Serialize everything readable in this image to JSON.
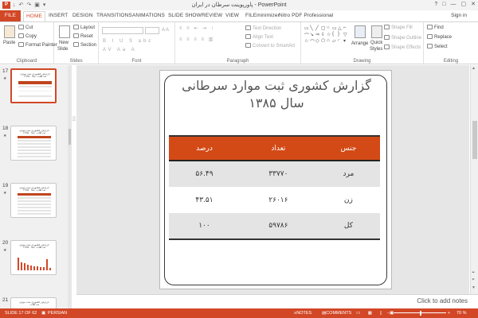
{
  "window": {
    "title": "پاورپوینت سرطان در ایران - PowerPoint",
    "app_icon": "P",
    "qat": [
      "↓",
      "↶",
      "↷",
      "▣",
      "▾"
    ],
    "controls": [
      "?",
      "□",
      "—",
      "▢",
      "✕"
    ]
  },
  "tabs": {
    "file": "FILE",
    "items": [
      "HOME",
      "INSERT",
      "DESIGN",
      "TRANSITIONS",
      "ANIMATIONS",
      "SLIDE SHOW",
      "REVIEW",
      "VIEW",
      "FILEminimizer",
      "Nitro PDF Professional"
    ],
    "active": "HOME",
    "signin": "Sign in"
  },
  "ribbon": {
    "clipboard": {
      "paste": "Paste",
      "cut": "Cut",
      "copy": "Copy",
      "format_painter": "Format Painter",
      "label": "Clipboard"
    },
    "slides": {
      "new_slide": "New",
      "new_slide2": "Slide",
      "layout": "Layout",
      "reset": "Reset",
      "section": "Section",
      "label": "Slides"
    },
    "font": {
      "label": "Font"
    },
    "paragraph": {
      "text_direction": "Text Direction",
      "align_text": "Align Text",
      "convert": "Convert to SmartArt",
      "label": "Paragraph"
    },
    "drawing": {
      "arrange": "Arrange",
      "quick_styles": "Quick",
      "quick_styles2": "Styles",
      "shape_fill": "Shape Fill",
      "shape_outline": "Shape Outline",
      "shape_effects": "Shape Effects",
      "label": "Drawing"
    },
    "editing": {
      "find": "Find",
      "replace": "Replace",
      "select": "Select",
      "label": "Editing"
    }
  },
  "slides_panel": {
    "thumbnails": [
      {
        "num": "17",
        "title": "گزارش کشوری ثبت موارد سرطانی سال ۱۳۸۵",
        "kind": "table",
        "selected": true
      },
      {
        "num": "18",
        "title": "گزارش کشوری ثبت موارد سرطانی سال ۱۳۸۵",
        "kind": "table",
        "selected": false
      },
      {
        "num": "19",
        "title": "گزارش کشوری ثبت موارد سرطانی سال ۱۳۸۵",
        "kind": "table",
        "selected": false
      },
      {
        "num": "20",
        "title": "گزارش کشوری ثبت موارد سرطانی سال ۱۳۸۵",
        "kind": "chart",
        "selected": false
      },
      {
        "num": "21",
        "title": "گزارش کشوری ثبت موارد سرطانی",
        "kind": "table",
        "selected": false
      }
    ]
  },
  "slide": {
    "title_line1": "گزارش کشوری ثبت موارد سرطانی",
    "title_line2": "سال ۱۳۸۵",
    "table": {
      "headers": [
        "جنس",
        "تعداد",
        "درصد"
      ],
      "rows": [
        [
          "مرد",
          "۳۳۷۷۰",
          "۵۶.۴۹"
        ],
        [
          "زن",
          "۲۶۰۱۶",
          "۴۳.۵۱"
        ],
        [
          "کل",
          "۵۹۷۸۶",
          "۱۰۰"
        ]
      ]
    }
  },
  "notes": {
    "placeholder": "Click to add notes"
  },
  "status": {
    "slide_info": "SLIDE 17 OF 62",
    "language": "PERSIAN",
    "notes": "NOTES",
    "comments": "COMMENTS",
    "zoom": "70 %"
  },
  "colors": {
    "accent": "#d24726",
    "table_header": "#d34a16",
    "row_alt": "#e4e4e4"
  }
}
